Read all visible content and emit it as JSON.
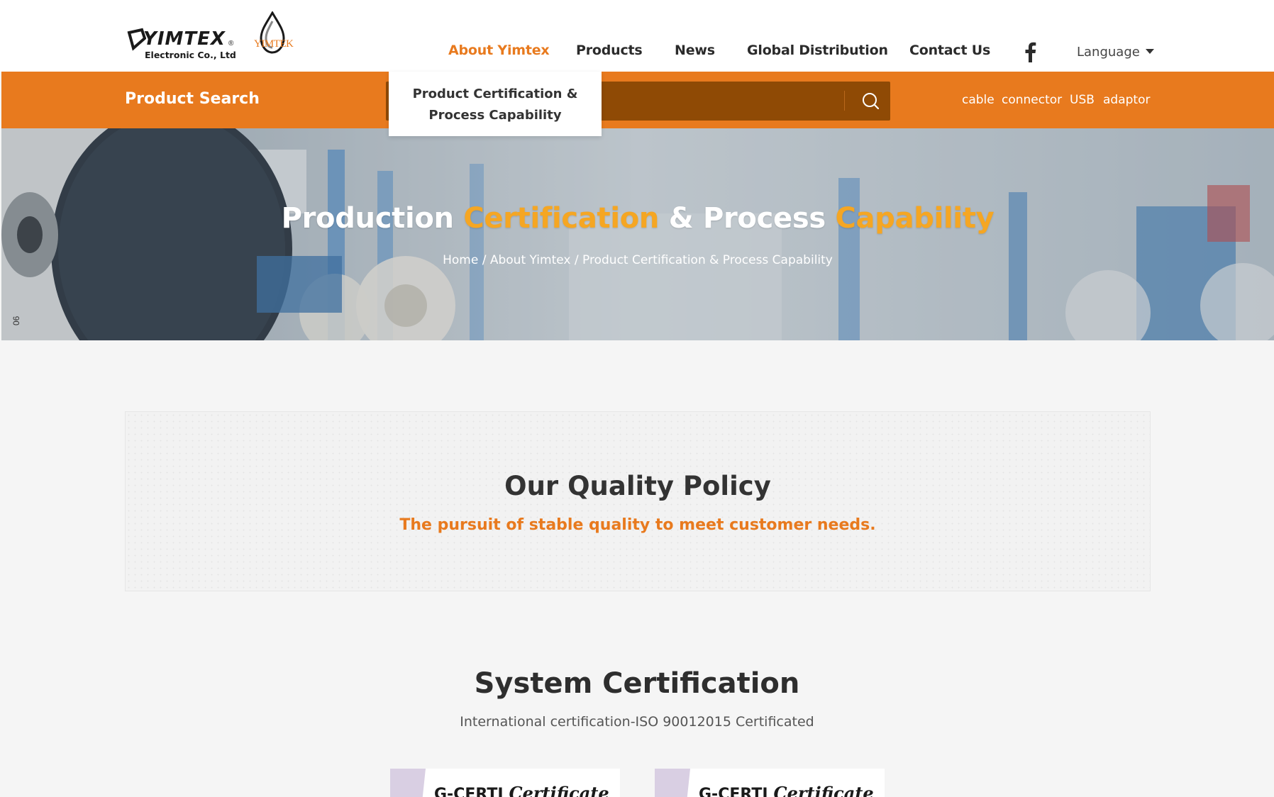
{
  "brand": {
    "name": "YIMTEX",
    "reg_mark": "®",
    "subtitle": "Electronic Co., Ltd",
    "secondary_logo_text": "YIMTEK"
  },
  "nav": {
    "items": [
      {
        "label": "About Yimtex",
        "active": true
      },
      {
        "label": "Products",
        "active": false
      },
      {
        "label": "News",
        "active": false
      },
      {
        "label": "Global Distribution",
        "active": false
      },
      {
        "label": "Contact Us",
        "active": false
      }
    ],
    "social_icon": "facebook-icon",
    "language_label": "Language"
  },
  "dropdown": {
    "item": "Product Certification & Process Capability"
  },
  "search": {
    "label": "Product Search",
    "placeholder": "",
    "value": "",
    "button_icon": "search-icon",
    "tags": [
      "cable",
      "connector",
      "USB",
      "adaptor"
    ]
  },
  "hero": {
    "title_parts": [
      "Production",
      "Certification",
      "& Process",
      "Capability"
    ],
    "breadcrumb": [
      "Home",
      "About Yimtex",
      "Product Certification & Process Capability"
    ],
    "separator": " / ",
    "side_text": "06"
  },
  "policy": {
    "title": "Our Quality Policy",
    "subtitle": "The pursuit of stable quality to meet customer needs."
  },
  "system": {
    "title": "System Certification",
    "subtitle": "International certification-ISO 90012015 Certificated",
    "cards": [
      {
        "brand": "G-CERTI",
        "script": "Certificate"
      },
      {
        "brand": "G-CERTI",
        "script": "Certificate"
      }
    ]
  },
  "colors": {
    "accent": "#e87a1e",
    "highlight": "#f5a623",
    "search_box": "#8f4a05"
  }
}
